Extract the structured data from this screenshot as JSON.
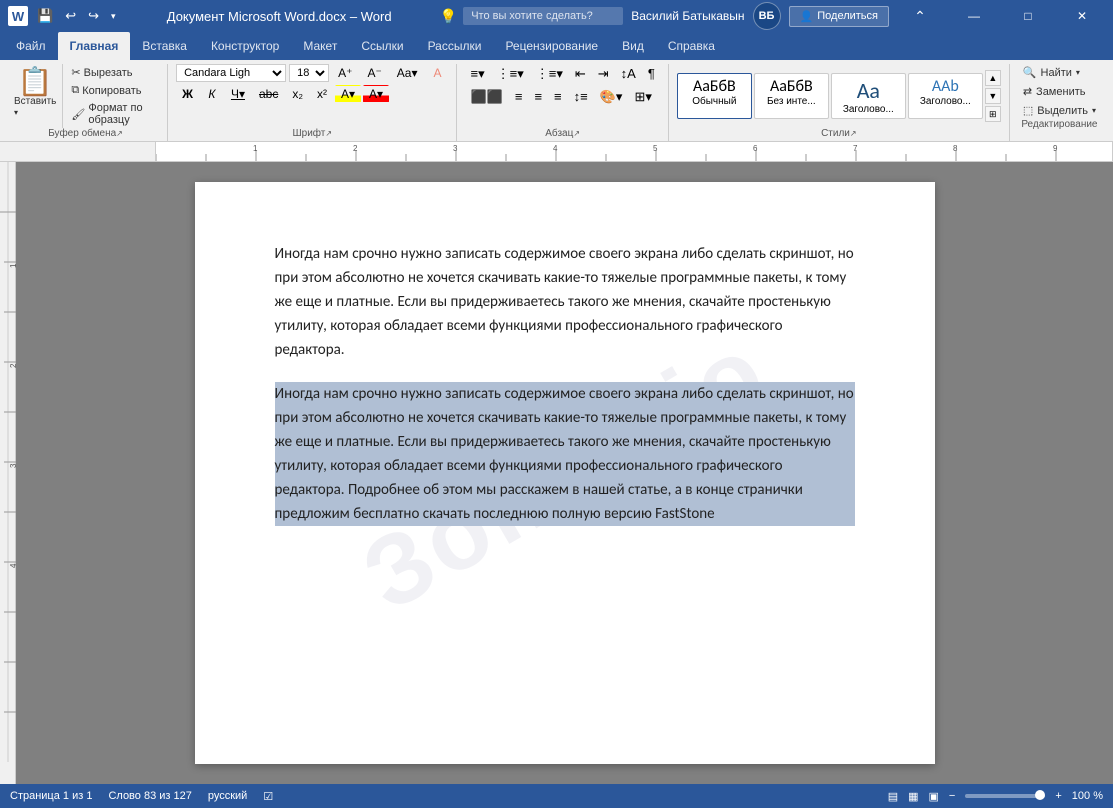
{
  "titlebar": {
    "title": "Документ Microsoft Word.docx  –  Word",
    "app": "Word",
    "user": "Василий Батыкавын",
    "user_initials": "ВБ",
    "buttons": {
      "minimize": "—",
      "maximize": "□",
      "close": "✕"
    }
  },
  "ribbon": {
    "tabs": [
      "Файл",
      "Главная",
      "Вставка",
      "Конструктор",
      "Макет",
      "Ссылки",
      "Рассылки",
      "Рецензирование",
      "Вид",
      "Справка"
    ],
    "active_tab": "Главная",
    "groups": {
      "clipboard": {
        "label": "Буфер обмена",
        "paste_label": "Вставить",
        "buttons": [
          "Вырезать",
          "Копировать",
          "Формат по образцу"
        ]
      },
      "font": {
        "label": "Шрифт",
        "font_name": "Candara Ligh",
        "font_size": "18",
        "buttons": [
          "Ж",
          "К",
          "Ч",
          "abc",
          "x₂",
          "x²",
          "A",
          "A"
        ]
      },
      "paragraph": {
        "label": "Абзац",
        "buttons": [
          "≡",
          "≡",
          "≡",
          "≡"
        ]
      },
      "styles": {
        "label": "Стили",
        "items": [
          {
            "label": "Обычный",
            "preview": "АаБбВ",
            "active": true
          },
          {
            "label": "Без инте...",
            "preview": "АаБбВ"
          },
          {
            "label": "Заголово...",
            "preview": "Аа",
            "large": true
          },
          {
            "label": "Заголово...",
            "preview": "ААb"
          }
        ]
      },
      "editing": {
        "label": "Редактирование",
        "buttons": [
          "Найти",
          "Заменить",
          "Выделить"
        ]
      }
    }
  },
  "document": {
    "paragraph1": "Иногда нам срочно нужно записать содержимое своего экрана либо сделать скриншот, но при этом абсолютно не хочется скачивать какие-то тяжелые программные пакеты, к тому же еще и платные. Если вы придерживаетесь такого же мнения, скачайте простенькую утилиту, которая обладает всеми функциями профессионального графического редактора.",
    "paragraph2": "Иногда нам срочно нужно записать содержимое своего экрана либо сделать скриншот, но при этом абсолютно не хочется скачивать какие-то тяжелые программные пакеты, к тому же еще и платные. Если вы придерживаетесь такого же мнения, скачайте простенькую утилиту, которая обладает всеми функциями профессионального графического редактора. Подробнее об этом мы расскажем в нашей статье, а в конце странички предложим бесплатно скачать последнюю полную версию FastStone",
    "watermark": "Зomilejo"
  },
  "statusbar": {
    "page": "Страница 1 из 1",
    "words": "Слово 83 из 127",
    "language": "русский",
    "layout_icons": [
      "▦",
      "▤",
      "▣"
    ],
    "zoom_level": "100 %"
  },
  "help": {
    "placeholder": "Что вы хотите сделать?",
    "share_label": "Поделиться"
  }
}
